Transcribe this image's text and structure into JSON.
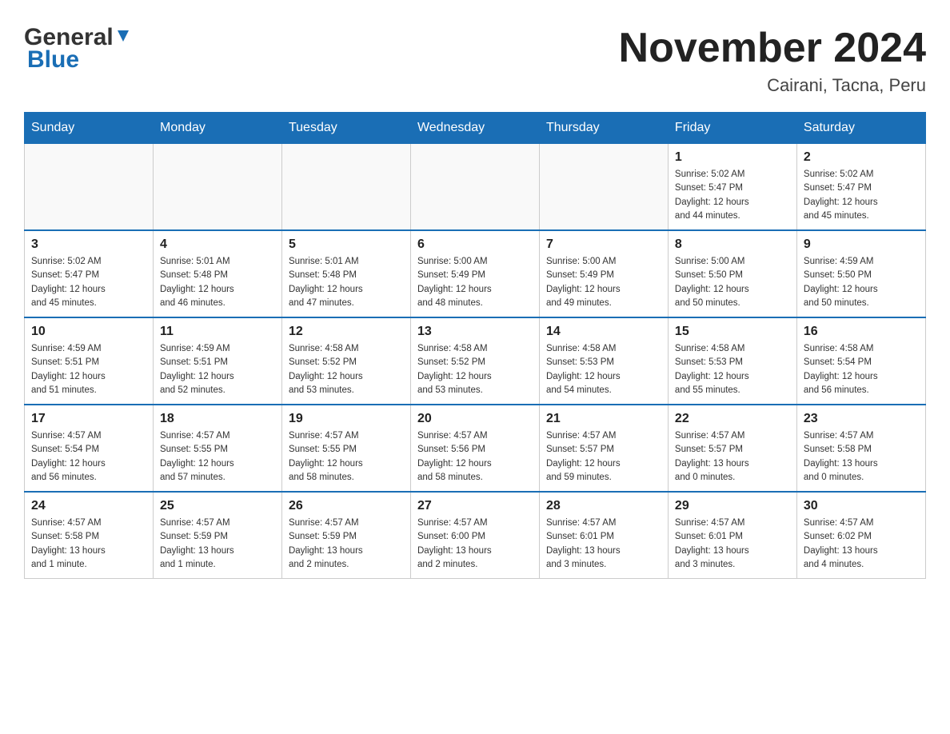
{
  "header": {
    "logo_general": "General",
    "logo_blue": "Blue",
    "title": "November 2024",
    "location": "Cairani, Tacna, Peru"
  },
  "weekdays": [
    "Sunday",
    "Monday",
    "Tuesday",
    "Wednesday",
    "Thursday",
    "Friday",
    "Saturday"
  ],
  "weeks": [
    [
      {
        "day": "",
        "info": ""
      },
      {
        "day": "",
        "info": ""
      },
      {
        "day": "",
        "info": ""
      },
      {
        "day": "",
        "info": ""
      },
      {
        "day": "",
        "info": ""
      },
      {
        "day": "1",
        "info": "Sunrise: 5:02 AM\nSunset: 5:47 PM\nDaylight: 12 hours\nand 44 minutes."
      },
      {
        "day": "2",
        "info": "Sunrise: 5:02 AM\nSunset: 5:47 PM\nDaylight: 12 hours\nand 45 minutes."
      }
    ],
    [
      {
        "day": "3",
        "info": "Sunrise: 5:02 AM\nSunset: 5:47 PM\nDaylight: 12 hours\nand 45 minutes."
      },
      {
        "day": "4",
        "info": "Sunrise: 5:01 AM\nSunset: 5:48 PM\nDaylight: 12 hours\nand 46 minutes."
      },
      {
        "day": "5",
        "info": "Sunrise: 5:01 AM\nSunset: 5:48 PM\nDaylight: 12 hours\nand 47 minutes."
      },
      {
        "day": "6",
        "info": "Sunrise: 5:00 AM\nSunset: 5:49 PM\nDaylight: 12 hours\nand 48 minutes."
      },
      {
        "day": "7",
        "info": "Sunrise: 5:00 AM\nSunset: 5:49 PM\nDaylight: 12 hours\nand 49 minutes."
      },
      {
        "day": "8",
        "info": "Sunrise: 5:00 AM\nSunset: 5:50 PM\nDaylight: 12 hours\nand 50 minutes."
      },
      {
        "day": "9",
        "info": "Sunrise: 4:59 AM\nSunset: 5:50 PM\nDaylight: 12 hours\nand 50 minutes."
      }
    ],
    [
      {
        "day": "10",
        "info": "Sunrise: 4:59 AM\nSunset: 5:51 PM\nDaylight: 12 hours\nand 51 minutes."
      },
      {
        "day": "11",
        "info": "Sunrise: 4:59 AM\nSunset: 5:51 PM\nDaylight: 12 hours\nand 52 minutes."
      },
      {
        "day": "12",
        "info": "Sunrise: 4:58 AM\nSunset: 5:52 PM\nDaylight: 12 hours\nand 53 minutes."
      },
      {
        "day": "13",
        "info": "Sunrise: 4:58 AM\nSunset: 5:52 PM\nDaylight: 12 hours\nand 53 minutes."
      },
      {
        "day": "14",
        "info": "Sunrise: 4:58 AM\nSunset: 5:53 PM\nDaylight: 12 hours\nand 54 minutes."
      },
      {
        "day": "15",
        "info": "Sunrise: 4:58 AM\nSunset: 5:53 PM\nDaylight: 12 hours\nand 55 minutes."
      },
      {
        "day": "16",
        "info": "Sunrise: 4:58 AM\nSunset: 5:54 PM\nDaylight: 12 hours\nand 56 minutes."
      }
    ],
    [
      {
        "day": "17",
        "info": "Sunrise: 4:57 AM\nSunset: 5:54 PM\nDaylight: 12 hours\nand 56 minutes."
      },
      {
        "day": "18",
        "info": "Sunrise: 4:57 AM\nSunset: 5:55 PM\nDaylight: 12 hours\nand 57 minutes."
      },
      {
        "day": "19",
        "info": "Sunrise: 4:57 AM\nSunset: 5:55 PM\nDaylight: 12 hours\nand 58 minutes."
      },
      {
        "day": "20",
        "info": "Sunrise: 4:57 AM\nSunset: 5:56 PM\nDaylight: 12 hours\nand 58 minutes."
      },
      {
        "day": "21",
        "info": "Sunrise: 4:57 AM\nSunset: 5:57 PM\nDaylight: 12 hours\nand 59 minutes."
      },
      {
        "day": "22",
        "info": "Sunrise: 4:57 AM\nSunset: 5:57 PM\nDaylight: 13 hours\nand 0 minutes."
      },
      {
        "day": "23",
        "info": "Sunrise: 4:57 AM\nSunset: 5:58 PM\nDaylight: 13 hours\nand 0 minutes."
      }
    ],
    [
      {
        "day": "24",
        "info": "Sunrise: 4:57 AM\nSunset: 5:58 PM\nDaylight: 13 hours\nand 1 minute."
      },
      {
        "day": "25",
        "info": "Sunrise: 4:57 AM\nSunset: 5:59 PM\nDaylight: 13 hours\nand 1 minute."
      },
      {
        "day": "26",
        "info": "Sunrise: 4:57 AM\nSunset: 5:59 PM\nDaylight: 13 hours\nand 2 minutes."
      },
      {
        "day": "27",
        "info": "Sunrise: 4:57 AM\nSunset: 6:00 PM\nDaylight: 13 hours\nand 2 minutes."
      },
      {
        "day": "28",
        "info": "Sunrise: 4:57 AM\nSunset: 6:01 PM\nDaylight: 13 hours\nand 3 minutes."
      },
      {
        "day": "29",
        "info": "Sunrise: 4:57 AM\nSunset: 6:01 PM\nDaylight: 13 hours\nand 3 minutes."
      },
      {
        "day": "30",
        "info": "Sunrise: 4:57 AM\nSunset: 6:02 PM\nDaylight: 13 hours\nand 4 minutes."
      }
    ]
  ]
}
